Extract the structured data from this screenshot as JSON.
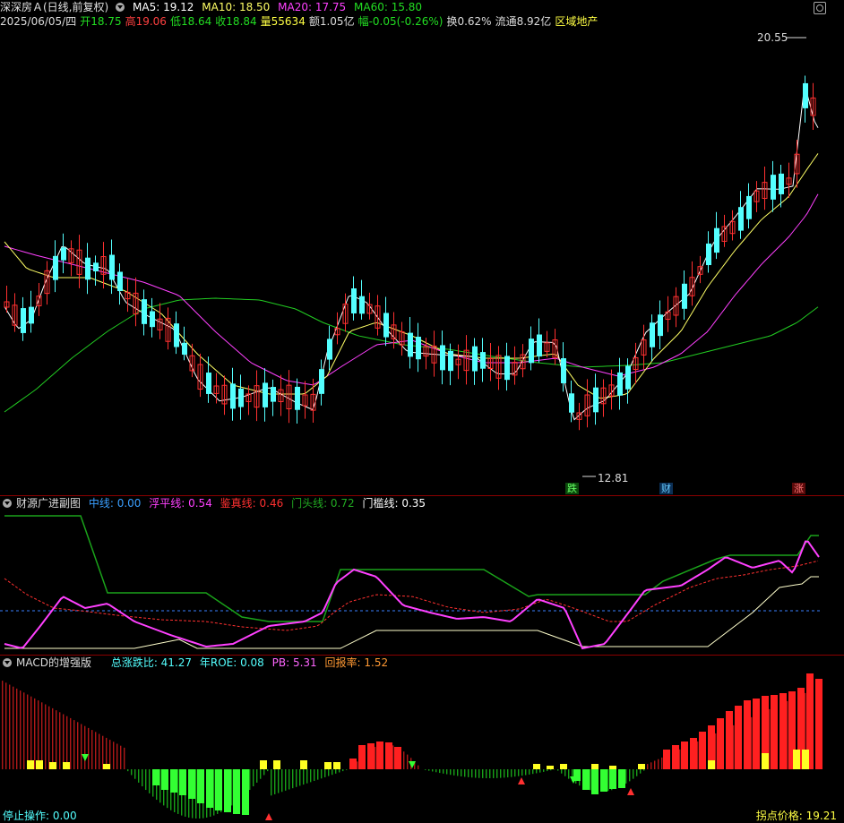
{
  "main_header": {
    "title": "深深房Ａ(日线,前复权)",
    "ma5_label": "MA5: 19.12",
    "ma10_label": "MA10: 18.50",
    "ma20_label": "MA20: 17.75",
    "ma60_label": "MA60: 15.80"
  },
  "quote_line": {
    "date": "2025/06/05/四",
    "open": "开18.75",
    "high": "高19.06",
    "low": "低18.64",
    "close": "收18.84",
    "volume": "量55634",
    "amount": "额1.05亿",
    "change": "幅-0.05(-0.26%)",
    "turnover": "换0.62%",
    "float_cap": "流通8.92亿",
    "sector": "区域地产"
  },
  "annotations": {
    "high_price": "20.55",
    "low_price": "12.81",
    "marker_die": "跌",
    "marker_cai": "财",
    "marker_zhang": "涨"
  },
  "indicator_header": {
    "title": "财源广进副图",
    "zhongxian": "中线: 0.00",
    "fuping": "浮平线: 0.54",
    "jianzhen": "鉴真线: 0.46",
    "mentou": "门头线: 0.72",
    "menkan": "门槛线: 0.35"
  },
  "macd_header": {
    "title": "MACD的增强版",
    "zongzhang": "总涨跌比: 41.27",
    "roe": "年ROE: 0.08",
    "pb": "PB: 5.31",
    "huibao": "回报率: 1.52"
  },
  "footer": {
    "stop_op": "停止操作: 0.00",
    "turn_price": "拐点价格: 19.21"
  },
  "colors": {
    "up": "#ff3030",
    "down": "#54ffff",
    "ma5": "#ffffff",
    "ma10": "#ffff66",
    "ma20": "#ff40ff",
    "ma60": "#22cc22",
    "green_line": "#1aa31a",
    "magenta_line": "#ff40ff",
    "red_dash": "#ff3030",
    "blue_dash": "#3a7fff",
    "white_line": "#ffffcc"
  }
}
